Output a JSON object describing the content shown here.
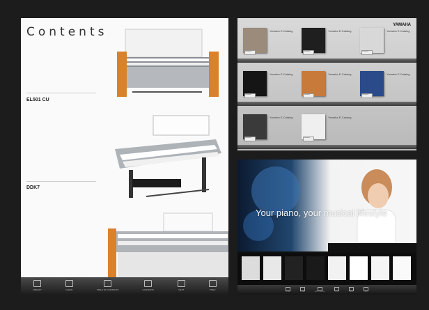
{
  "contents": {
    "title": "Contents",
    "entries": [
      {
        "label": "EL501 CU"
      },
      {
        "label": "DDK7"
      }
    ],
    "toolbar": [
      {
        "label": "Library",
        "icon": "library-icon"
      },
      {
        "label": "Clear",
        "icon": "star-icon"
      },
      {
        "label": "Table of Contents",
        "icon": "toc-icon"
      },
      {
        "label": "Contents",
        "icon": "contents-icon"
      },
      {
        "label": "Next",
        "icon": "next-icon"
      },
      {
        "label": "Prev",
        "icon": "prev-icon"
      }
    ]
  },
  "shelf": {
    "brand": "YAMAHA",
    "book_button": "Download",
    "books": [
      {
        "title": "Yamaha E-Catalog",
        "cover": "#9b8b7a"
      },
      {
        "title": "Yamaha E-Catalog",
        "cover": "#1f1f1f"
      },
      {
        "title": "Yamaha E-Catalog",
        "cover": "#d8d8d8"
      },
      {
        "title": "Yamaha E-Catalog",
        "cover": "#151515"
      },
      {
        "title": "Yamaha E-Catalog",
        "cover": "#c87a3a"
      },
      {
        "title": "Yamaha E-Catalog",
        "cover": "#2a4a8a"
      },
      {
        "title": "Yamaha E-Catalog",
        "cover": "#3a3a3a"
      },
      {
        "title": "Yamaha E-Catalog",
        "cover": "#efefef"
      }
    ]
  },
  "promo": {
    "headline": "Your piano, your musical lifestyle",
    "thumbs": [
      "#dcdcdc",
      "#e8e8e8",
      "#222222",
      "#1a1a1a",
      "#f2f2f2",
      "#ffffff",
      "#f5f5f5",
      "#fafafa"
    ],
    "toolbar": [
      {
        "label": "Home",
        "icon": "home-icon"
      },
      {
        "label": "Clear",
        "icon": "star-icon"
      },
      {
        "label": "Select Mode",
        "icon": "select-icon"
      },
      {
        "label": "Flip",
        "icon": "flip-icon"
      },
      {
        "label": "Help",
        "icon": "help-icon"
      },
      {
        "label": "Info",
        "icon": "info-icon"
      }
    ]
  }
}
